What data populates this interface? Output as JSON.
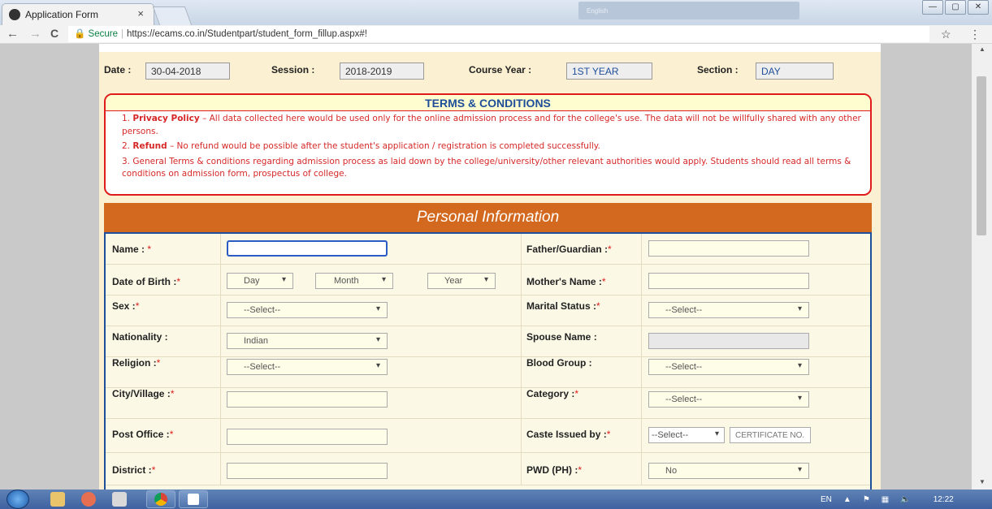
{
  "browser": {
    "tab_title": "Application Form",
    "tab_close": "×",
    "ime_label": "English",
    "url_secure": "Secure",
    "url": "https://ecams.co.in/Studentpart/student_form_fillup.aspx#!",
    "back": "←",
    "forward": "→",
    "reload": "C",
    "star": "☆",
    "menu": "⋮",
    "win_min": "—",
    "win_max": "▢",
    "win_close": "✕"
  },
  "header": {
    "date_label": "Date :",
    "date_value": "30-04-2018",
    "session_label": "Session :",
    "session_value": "2018-2019",
    "course_year_label": "Course Year :",
    "course_year_value": "1ST YEAR",
    "section_label": "Section :",
    "section_value": "DAY"
  },
  "terms": {
    "title": "TERMS & CONDITIONS",
    "items": [
      {
        "num": "1.",
        "bold": "Privacy Policy",
        "text": " – All data collected here would be used only for the online admission process and for the college's use. The data will not be willfully shared with any other persons."
      },
      {
        "num": "2.",
        "bold": "Refund",
        "text": " – No refund would be possible after the student's application / registration is completed successfully."
      },
      {
        "num": "3.",
        "bold": "",
        "text": "General Terms & conditions regarding admission process as laid down by the college/university/other relevant authorities would apply. Students should read all terms & conditions on admission form, prospectus of college."
      }
    ]
  },
  "section_title": "Personal Information",
  "form": {
    "name_label": "Name :",
    "dob_label": "Date of Birth :",
    "dob_day": "Day",
    "dob_month": "Month",
    "dob_year": "Year",
    "sex_label": "Sex :",
    "sex_value": "--Select--",
    "nationality_label": "Nationality :",
    "nationality_value": "Indian",
    "religion_label": "Religion :",
    "religion_value": "--Select--",
    "city_label": "City/Village :",
    "post_office_label": "Post Office :",
    "district_label": "District :",
    "father_label": "Father/Guardian :",
    "mother_label": "Mother's Name :",
    "marital_label": "Marital Status :",
    "marital_value": "--Select--",
    "spouse_label": "Spouse Name :",
    "blood_label": "Blood Group :",
    "blood_value": "--Select--",
    "category_label": "Category :",
    "category_value": "--Select--",
    "caste_label": "Caste Issued by :",
    "caste_value": "--Select--",
    "certificate_placeholder": "CERTIFICATE NO.",
    "pwd_label": "PWD (PH) :",
    "pwd_value": "No",
    "required_mark": "*"
  },
  "taskbar": {
    "lang": "EN",
    "time": "12:22"
  },
  "colors": {
    "accent_orange": "#d2691e",
    "terms_red": "#e01b1b",
    "form_blue": "#1f4f99"
  }
}
